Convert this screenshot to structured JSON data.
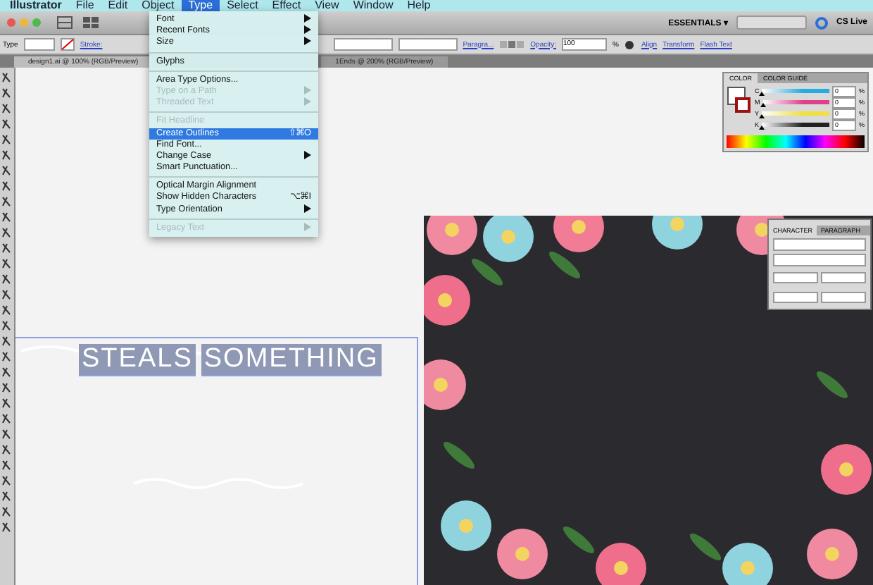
{
  "menu_bar": {
    "items": [
      {
        "label": "Illustrator",
        "selected": false
      },
      {
        "label": "File",
        "selected": false
      },
      {
        "label": "Edit",
        "selected": false
      },
      {
        "label": "Object",
        "selected": false
      },
      {
        "label": "Type",
        "selected": true
      },
      {
        "label": "Select",
        "selected": false
      },
      {
        "label": "Effect",
        "selected": false
      },
      {
        "label": "View",
        "selected": false
      },
      {
        "label": "Window",
        "selected": false
      },
      {
        "label": "Help",
        "selected": false
      }
    ]
  },
  "app_bar": {
    "workspace": "ESSENTIALS ▾",
    "cs_live": "CS Live"
  },
  "control_bar": {
    "tool": "Type",
    "stroke": "Stroke:",
    "paragraph": "Paragra...",
    "opacity_label": "Opacity:",
    "opacity": "100",
    "percent": "%",
    "links": [
      "Align",
      "Transform",
      "Flash Text"
    ]
  },
  "document_tabs": [
    {
      "label": "design1.ai @ 100% (RGB/Preview)",
      "selected": true
    },
    {
      "label": "1Ends @ 200% (RGB/Preview)",
      "selected": false
    }
  ],
  "type_menu": [
    {
      "kind": "item",
      "label": "Font",
      "submenu": true,
      "disabled": false,
      "selected": false
    },
    {
      "kind": "item",
      "label": "Recent Fonts",
      "submenu": true,
      "disabled": false,
      "selected": false
    },
    {
      "kind": "item",
      "label": "Size",
      "submenu": true,
      "disabled": false,
      "selected": false
    },
    {
      "kind": "separator"
    },
    {
      "kind": "item",
      "label": "Glyphs",
      "submenu": false,
      "disabled": false,
      "selected": false
    },
    {
      "kind": "separator"
    },
    {
      "kind": "item",
      "label": "Area Type Options...",
      "submenu": false,
      "disabled": false,
      "selected": false
    },
    {
      "kind": "item",
      "label": "Type on a Path",
      "submenu": true,
      "disabled": true,
      "selected": false
    },
    {
      "kind": "item",
      "label": "Threaded Text",
      "submenu": true,
      "disabled": true,
      "selected": false
    },
    {
      "kind": "separator"
    },
    {
      "kind": "item",
      "label": "Fit Headline",
      "submenu": false,
      "disabled": true,
      "selected": false
    },
    {
      "kind": "item",
      "label": "Create Outlines",
      "shortcut": "⇧⌘O",
      "submenu": false,
      "disabled": false,
      "selected": true
    },
    {
      "kind": "item",
      "label": "Find Font...",
      "submenu": false,
      "disabled": false,
      "selected": false
    },
    {
      "kind": "item",
      "label": "Change Case",
      "submenu": true,
      "disabled": false,
      "selected": false
    },
    {
      "kind": "item",
      "label": "Smart Punctuation...",
      "submenu": false,
      "disabled": false,
      "selected": false
    },
    {
      "kind": "separator"
    },
    {
      "kind": "item",
      "label": "Optical Margin Alignment",
      "submenu": false,
      "disabled": false,
      "selected": false
    },
    {
      "kind": "item",
      "label": "Show Hidden Characters",
      "shortcut": "⌥⌘I",
      "submenu": false,
      "disabled": false,
      "selected": false
    },
    {
      "kind": "item",
      "label": "Type Orientation",
      "submenu": true,
      "disabled": false,
      "selected": false
    },
    {
      "kind": "separator"
    },
    {
      "kind": "item",
      "label": "Legacy Text",
      "submenu": true,
      "disabled": true,
      "selected": false
    }
  ],
  "color_panel": {
    "tabs": [
      {
        "label": "COLOR",
        "selected": true
      },
      {
        "label": "COLOR GUIDE",
        "selected": false
      }
    ],
    "sliders": [
      {
        "name": "C",
        "level": 0,
        "value": "0",
        "unit": "%",
        "color": "#29abe2"
      },
      {
        "name": "M",
        "level": 0,
        "value": "0",
        "unit": "%",
        "color": "#e0408a"
      },
      {
        "name": "Y",
        "level": 0,
        "value": "0",
        "unit": "%",
        "color": "#f0e040"
      },
      {
        "name": "K",
        "level": 0,
        "value": "0",
        "unit": "%",
        "color": "#222222"
      }
    ]
  },
  "character_panel": {
    "tabs": [
      {
        "label": "CHARACTER",
        "selected": true
      },
      {
        "label": "PARAGRAPH",
        "selected": false
      }
    ]
  },
  "canvas_text": {
    "words": [
      "STEALS",
      "SOMETHING"
    ]
  }
}
